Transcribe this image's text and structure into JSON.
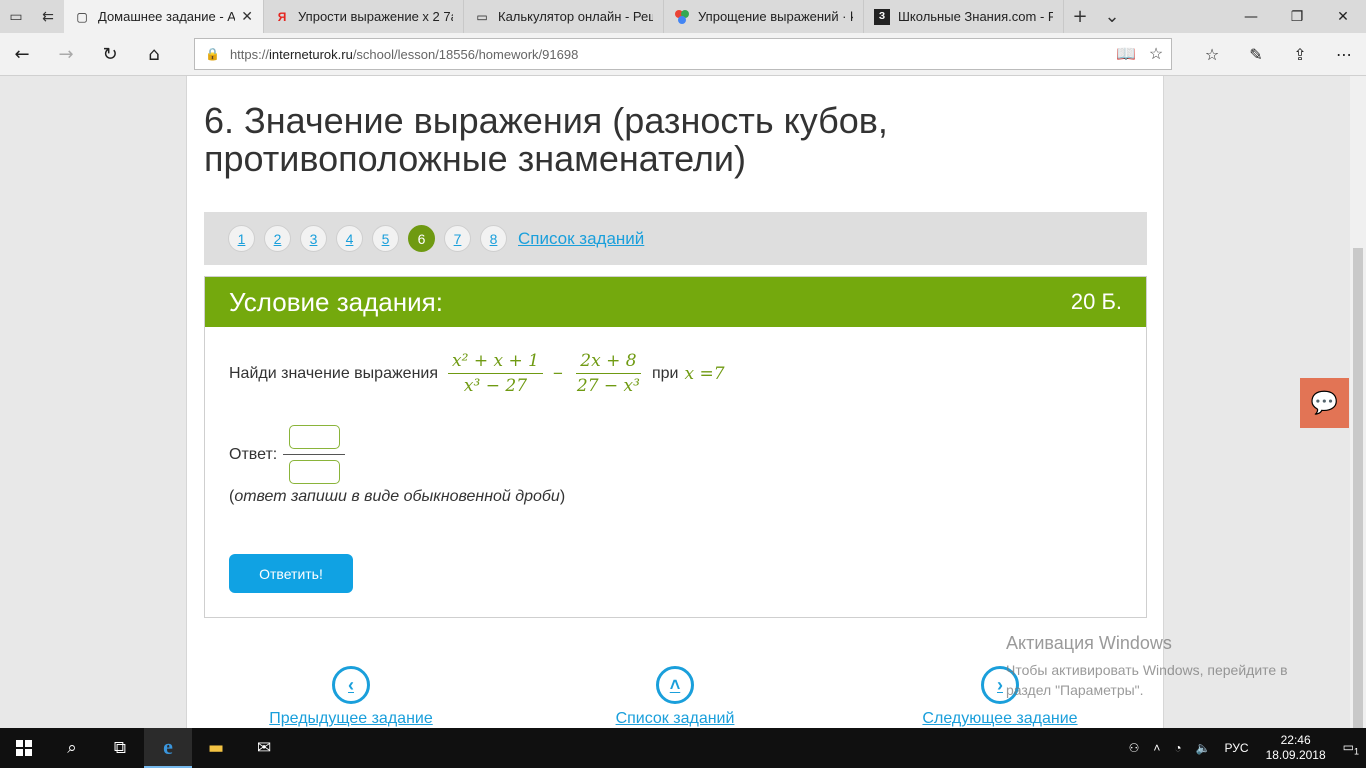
{
  "browser": {
    "tabs": [
      {
        "label": "Домашнее задание - А",
        "favicon": "page-icon",
        "active": true
      },
      {
        "label": "Упрости выражение x 2 7a",
        "favicon": "yandex-icon",
        "active": false
      },
      {
        "label": "Калькулятор онлайн - Реш",
        "favicon": "page-icon",
        "active": false
      },
      {
        "label": "Упрощение выражений · k",
        "favicon": "google-icon",
        "active": false
      },
      {
        "label": "Школьные Знания.com - Р",
        "favicon": "znanija-icon",
        "active": false
      }
    ],
    "url_prefix": "https://",
    "url_host": "interneturok.ru",
    "url_path": "/school/lesson/18556/homework/91698"
  },
  "page": {
    "title": "6. Значение выражения (разность кубов, противоположные знаменатели)",
    "pager": {
      "pages": [
        "1",
        "2",
        "3",
        "4",
        "5",
        "6",
        "7",
        "8"
      ],
      "active": "6",
      "list_link": "Список заданий"
    },
    "task": {
      "header": "Условие задания:",
      "points": "20 Б.",
      "question_prefix": "Найди значение выражения",
      "frac1_num": "x² + x + 1",
      "frac1_den": "x³ − 27",
      "minus": "−",
      "frac2_num": "2x + 8",
      "frac2_den": "27 − x³",
      "question_at": "при",
      "condition": "x =7",
      "answer_label": "Ответ:",
      "hint": "(ответ запиши в виде обыкновенной дроби)",
      "hint_open": "(",
      "hint_italic": "ответ запиши в виде обыкновенной дроби",
      "hint_close": ")",
      "submit_label": "Ответить!"
    },
    "bottom_nav": {
      "prev": "Предыдущее задание",
      "list": "Список заданий",
      "next": "Следующее задание"
    },
    "watermark": {
      "title": "Активация Windows",
      "text": "Чтобы активировать Windows, перейдите в раздел \"Параметры\"."
    }
  },
  "taskbar": {
    "lang": "РУС",
    "time": "22:46",
    "date": "18.09.2018",
    "notifications": "1"
  }
}
